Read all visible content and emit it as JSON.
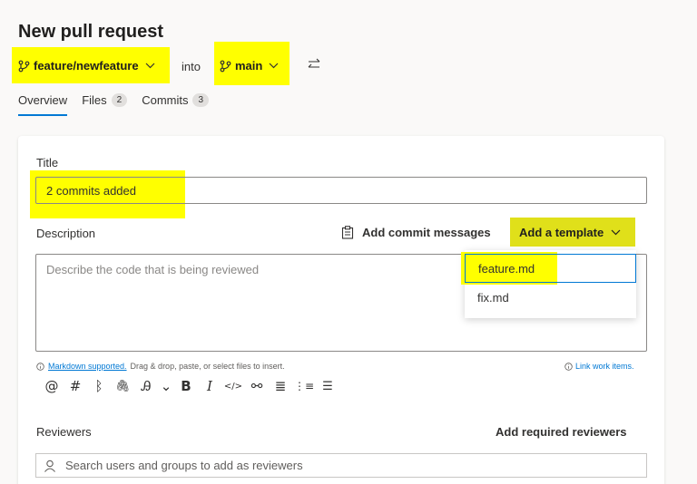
{
  "page": {
    "title": "New pull request"
  },
  "branches": {
    "source": "feature/newfeature",
    "into_label": "into",
    "target": "main"
  },
  "tabs": [
    {
      "label": "Overview",
      "badge": ""
    },
    {
      "label": "Files",
      "badge": "2"
    },
    {
      "label": "Commits",
      "badge": "3"
    }
  ],
  "form": {
    "title_label": "Title",
    "title_value": "2 commits added",
    "description_label": "Description",
    "add_commit_messages": "Add commit messages",
    "add_template": "Add a template",
    "description_placeholder": "Describe the code that is being reviewed",
    "template_options": [
      "feature.md",
      "fix.md"
    ],
    "markdown_link": "Markdown supported.",
    "markdown_hint": "Drag & drop, paste, or select files to insert.",
    "link_work_items": "Link work items."
  },
  "toolbar": {
    "mention": "@",
    "hash": "#",
    "pr_link": "ᛒ",
    "attach": "🖇",
    "format": "Ꭿ",
    "chevron": "⌄",
    "bold": "B",
    "italic": "I",
    "code": "</>",
    "link": "⚯",
    "bullets": "≣",
    "numbered": "⋮≡",
    "checklist": "☰"
  },
  "reviewers": {
    "label": "Reviewers",
    "add_required": "Add required reviewers",
    "search_placeholder": "Search users and groups to add as reviewers"
  },
  "colors": {
    "highlight": "#ffff00",
    "accent": "#0078d4"
  }
}
